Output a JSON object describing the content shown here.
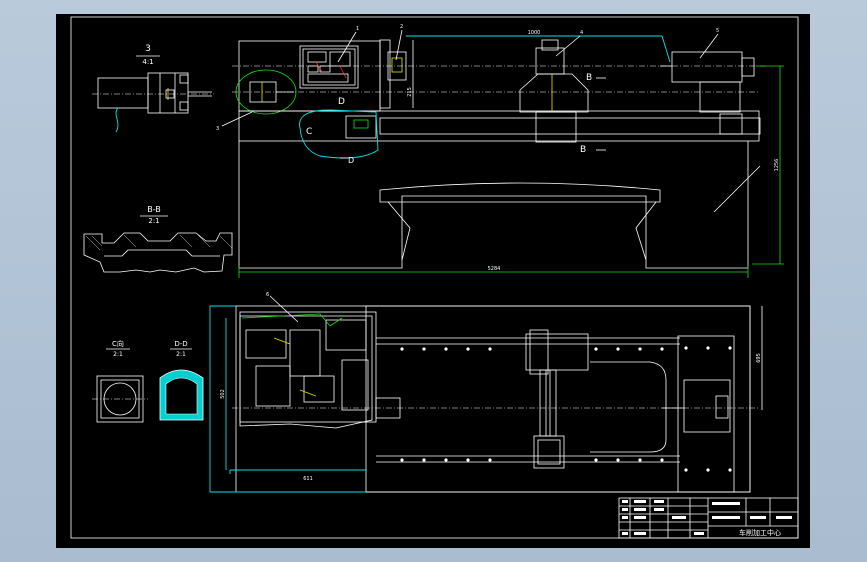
{
  "colors": {
    "background": "#b4c6d8",
    "paper": "#000000",
    "line_white": "#ffffff",
    "line_cyan": "#00e5e5",
    "line_green": "#19e019",
    "line_red": "#ff2a2a",
    "line_yellow": "#e5e500"
  },
  "views": {
    "detail_3": {
      "title": "3",
      "scale": "4:1"
    },
    "section_bb": {
      "title": "B-B",
      "scale": "2:1"
    },
    "view_c": {
      "title": "C向",
      "scale": "2:1"
    },
    "section_dd": {
      "title": "D-D",
      "scale": "2:1"
    }
  },
  "front_view": {
    "section_markers": {
      "b_upper": "B",
      "b_lower": "B",
      "c": "C",
      "d_upper": "D",
      "d_lower": "D"
    },
    "dims": {
      "top_length": "1000",
      "overall_length": "5284",
      "overall_height": "1256",
      "height_small": "215"
    },
    "balloons": {
      "b1": "1",
      "b2": "2",
      "b3": "3",
      "b4": "4",
      "b5": "5"
    }
  },
  "top_view": {
    "balloons": {
      "b6": "6"
    },
    "dims": {
      "bottom_length": "611",
      "left_height": "502",
      "right_height": "695"
    }
  },
  "title_block": {
    "title": "车削加工中心"
  }
}
